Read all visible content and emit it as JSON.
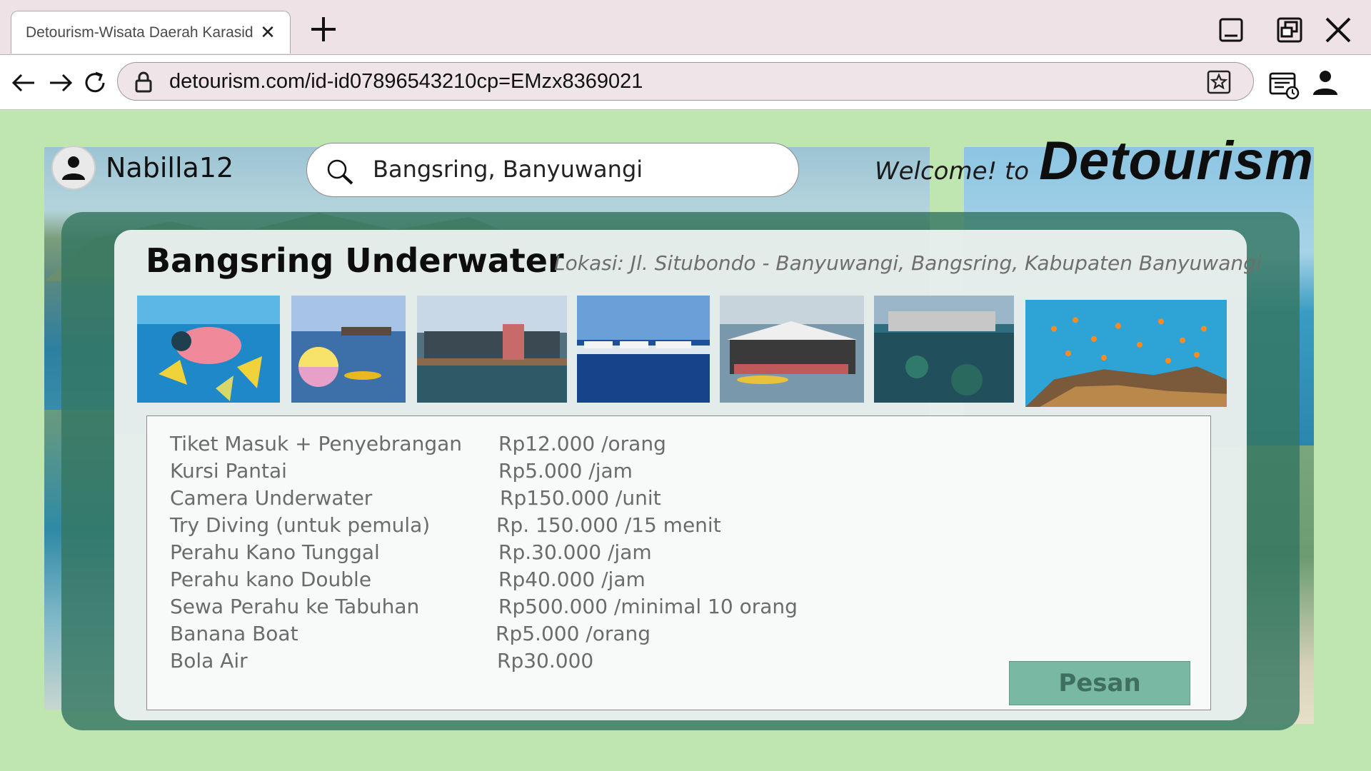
{
  "browser": {
    "tab_title": "Detourism-Wisata Daerah Karasid",
    "url": "detourism.com/id-id07896543210cp=EMzx8369021"
  },
  "header": {
    "username": "Nabilla12",
    "search_value": "Bangsring, Banyuwangi",
    "welcome": "Welcome! to",
    "logo": "Detourism"
  },
  "place": {
    "title": "Bangsring Underwater",
    "location": "Lokasi:  Jl. Situbondo - Banyuwangi, Bangsring, Kabupaten Banyuwangi"
  },
  "prices": [
    {
      "item": "Tiket Masuk + Penyebrangan",
      "price": "Rp12.000 /orang"
    },
    {
      "item": "Kursi Pantai",
      "price": "Rp5.000 /jam"
    },
    {
      "item": "Camera Underwater",
      "price": "Rp150.000 /unit"
    },
    {
      "item": "Try Diving (untuk pemula)",
      "price": "Rp. 150.000 /15 menit"
    },
    {
      "item": "Perahu Kano Tunggal",
      "price": "Rp.30.000 /jam"
    },
    {
      "item": "Perahu kano Double",
      "price": "Rp40.000 /jam"
    },
    {
      "item": "Sewa Perahu ke Tabuhan",
      "price": "Rp500.000 /minimal 10 orang"
    },
    {
      "item": "Banana Boat",
      "price": "Rp5.000 /orang"
    },
    {
      "item": "Bola Air",
      "price": "Rp30.000"
    }
  ],
  "order_button": "Pesan",
  "colors": {
    "page_background": "#bfe5b0",
    "panel": "#347662",
    "button": "#79b8a2",
    "tab_strip": "#efe2e6"
  },
  "icons": [
    "close-icon",
    "plus-icon",
    "minimize-icon",
    "restore-icon",
    "back-arrow-icon",
    "forward-arrow-icon",
    "reload-icon",
    "lock-icon",
    "favorite-star-icon",
    "extensions-icon",
    "profile-icon",
    "user-icon",
    "search-icon"
  ]
}
